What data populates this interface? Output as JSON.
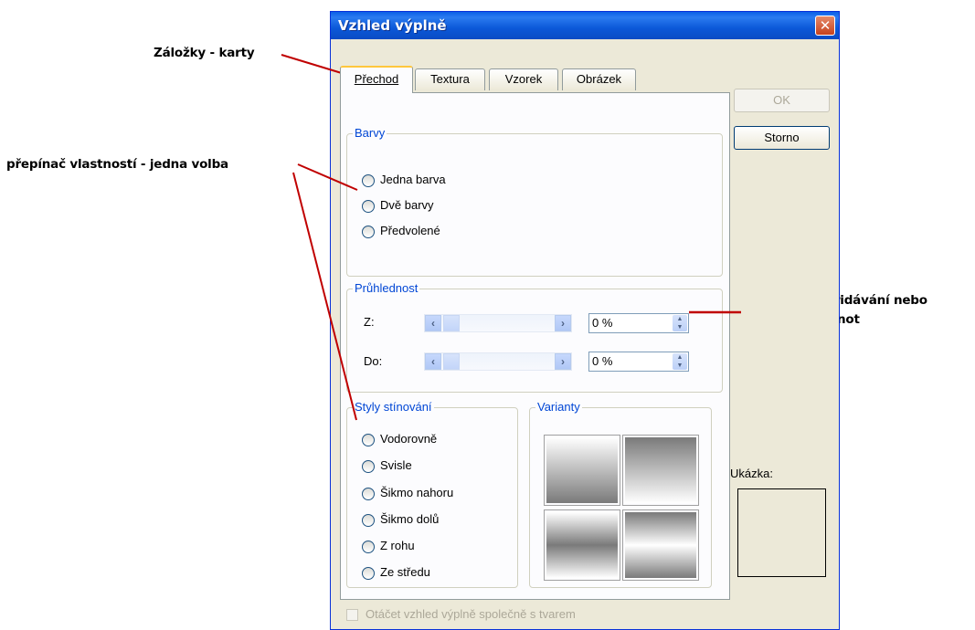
{
  "annotations": {
    "tabs_note": "Záložky - karty",
    "radio_note": "přepínač vlastností - jedna volba",
    "spinner_note_line1": "Číselník - přidávání nebo",
    "spinner_note_line2": "ubírání hodnot"
  },
  "dialog": {
    "title": "Vzhled výplně",
    "close_glyph": "✕",
    "tabs": [
      {
        "label": "Přechod",
        "active": true
      },
      {
        "label": "Textura",
        "active": false
      },
      {
        "label": "Vzorek",
        "active": false
      },
      {
        "label": "Obrázek",
        "active": false
      }
    ],
    "ok_label": "OK",
    "cancel_label": "Storno",
    "preview_label": "Ukázka:",
    "rotate_checkbox_label": "Otáčet vzhled výplně společně s tvarem",
    "colors": {
      "legend": "Barvy",
      "options": [
        "Jedna barva",
        "Dvě barvy",
        "Předvolené"
      ]
    },
    "transparency": {
      "legend": "Průhlednost",
      "from_label": "Z:",
      "from_value": "0 %",
      "to_label": "Do:",
      "to_value": "0 %"
    },
    "shading": {
      "legend": "Styly stínování",
      "options": [
        "Vodorovně",
        "Svisle",
        "Šikmo nahoru",
        "Šikmo dolů",
        "Z rohu",
        "Ze středu"
      ]
    },
    "variants": {
      "legend": "Varianty"
    }
  },
  "colors": {
    "titlebar": "#0a58d8",
    "dialog_bg": "#ece9d8",
    "group_label": "#0046d5",
    "annotation_line": "#c00000"
  }
}
